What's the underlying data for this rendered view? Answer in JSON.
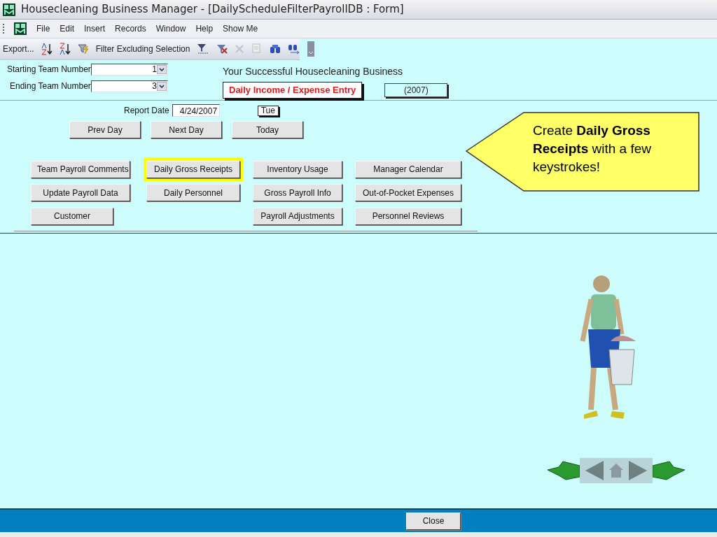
{
  "window": {
    "title": "Housecleaning Business Manager - [DailyScheduleFilterPayrollDB : Form]"
  },
  "menu": [
    "File",
    "Edit",
    "Insert",
    "Records",
    "Window",
    "Help",
    "Show Me"
  ],
  "toolbar": {
    "export_label": "Export...",
    "filter_label": "Filter Excluding Selection"
  },
  "header": {
    "fields": [
      {
        "label": "Starting Team Number",
        "value": "1"
      },
      {
        "label": "Ending Team Number",
        "value": "3"
      }
    ],
    "business": "Your Successful Housecleaning Business",
    "form_title": "Daily Income / Expense Entry",
    "year": "(2007)"
  },
  "report": {
    "label": "Report Date",
    "date": "4/24/2007",
    "weekday": "Tue"
  },
  "day_buttons": [
    "Prev Day",
    "Next Day",
    "Today"
  ],
  "button_columns": [
    [
      {
        "label": "Team Payroll Comments",
        "highlighted": false
      },
      {
        "label": "Update Payroll Data",
        "highlighted": false
      },
      {
        "label": "Customer",
        "highlighted": false
      }
    ],
    [
      {
        "label": "Daily Gross Receipts",
        "highlighted": true
      },
      {
        "label": "Daily Personnel",
        "highlighted": false
      }
    ],
    [
      {
        "label": "Inventory Usage",
        "highlighted": false
      },
      {
        "label": "Gross Payroll Info",
        "highlighted": false
      },
      {
        "label": "Payroll Adjustments",
        "highlighted": false
      }
    ],
    [
      {
        "label": "Manager Calendar",
        "highlighted": false
      },
      {
        "label": "Out-of-Pocket Expenses",
        "highlighted": false
      },
      {
        "label": "Personnel Reviews",
        "highlighted": false
      }
    ]
  ],
  "callout": "Create **Daily Gross Receipts** with a few keystrokes!",
  "footer": {
    "close_label": "Close"
  }
}
